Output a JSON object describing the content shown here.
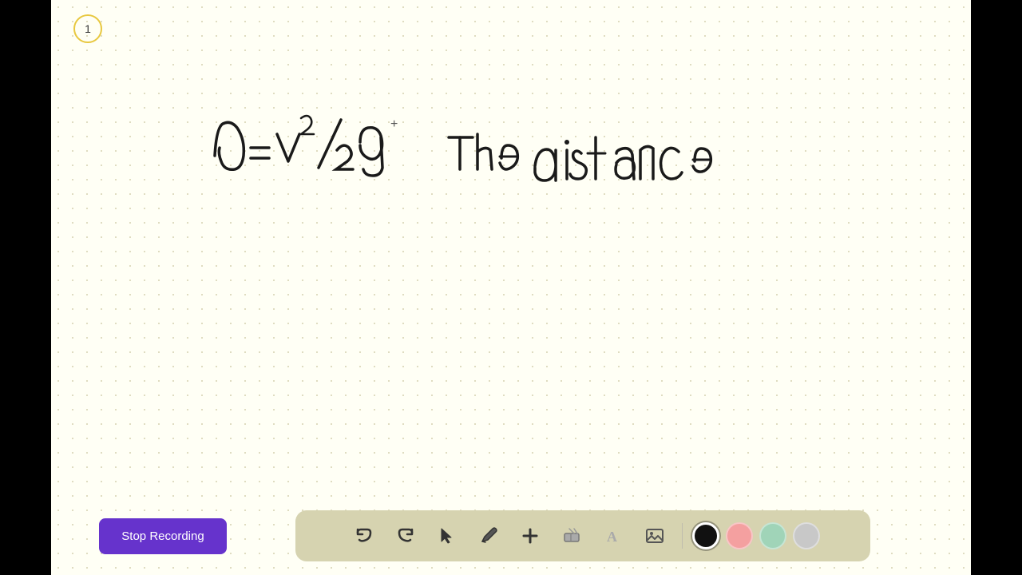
{
  "page": {
    "number": "1",
    "background_color": "#fffff5"
  },
  "stop_recording": {
    "label": "Stop Recording",
    "bg_color": "#6633cc"
  },
  "toolbar": {
    "tools": [
      {
        "name": "undo",
        "icon": "↺",
        "label": "Undo"
      },
      {
        "name": "redo",
        "icon": "↻",
        "label": "Redo"
      },
      {
        "name": "select",
        "icon": "▶",
        "label": "Select"
      },
      {
        "name": "pen",
        "icon": "✏",
        "label": "Pen"
      },
      {
        "name": "add",
        "icon": "+",
        "label": "Add"
      },
      {
        "name": "eraser",
        "icon": "◫",
        "label": "Eraser"
      },
      {
        "name": "text",
        "icon": "A",
        "label": "Text"
      },
      {
        "name": "image",
        "icon": "🖼",
        "label": "Image"
      }
    ],
    "colors": [
      {
        "name": "black",
        "value": "#111111",
        "active": true
      },
      {
        "name": "pink",
        "value": "#f4a0a0",
        "active": false
      },
      {
        "name": "mint",
        "value": "#a0d4b8",
        "active": false
      },
      {
        "name": "gray",
        "value": "#c8c8c8",
        "active": false
      }
    ]
  },
  "canvas_content": {
    "formula": "d=v²/2g",
    "text": "The distance"
  }
}
